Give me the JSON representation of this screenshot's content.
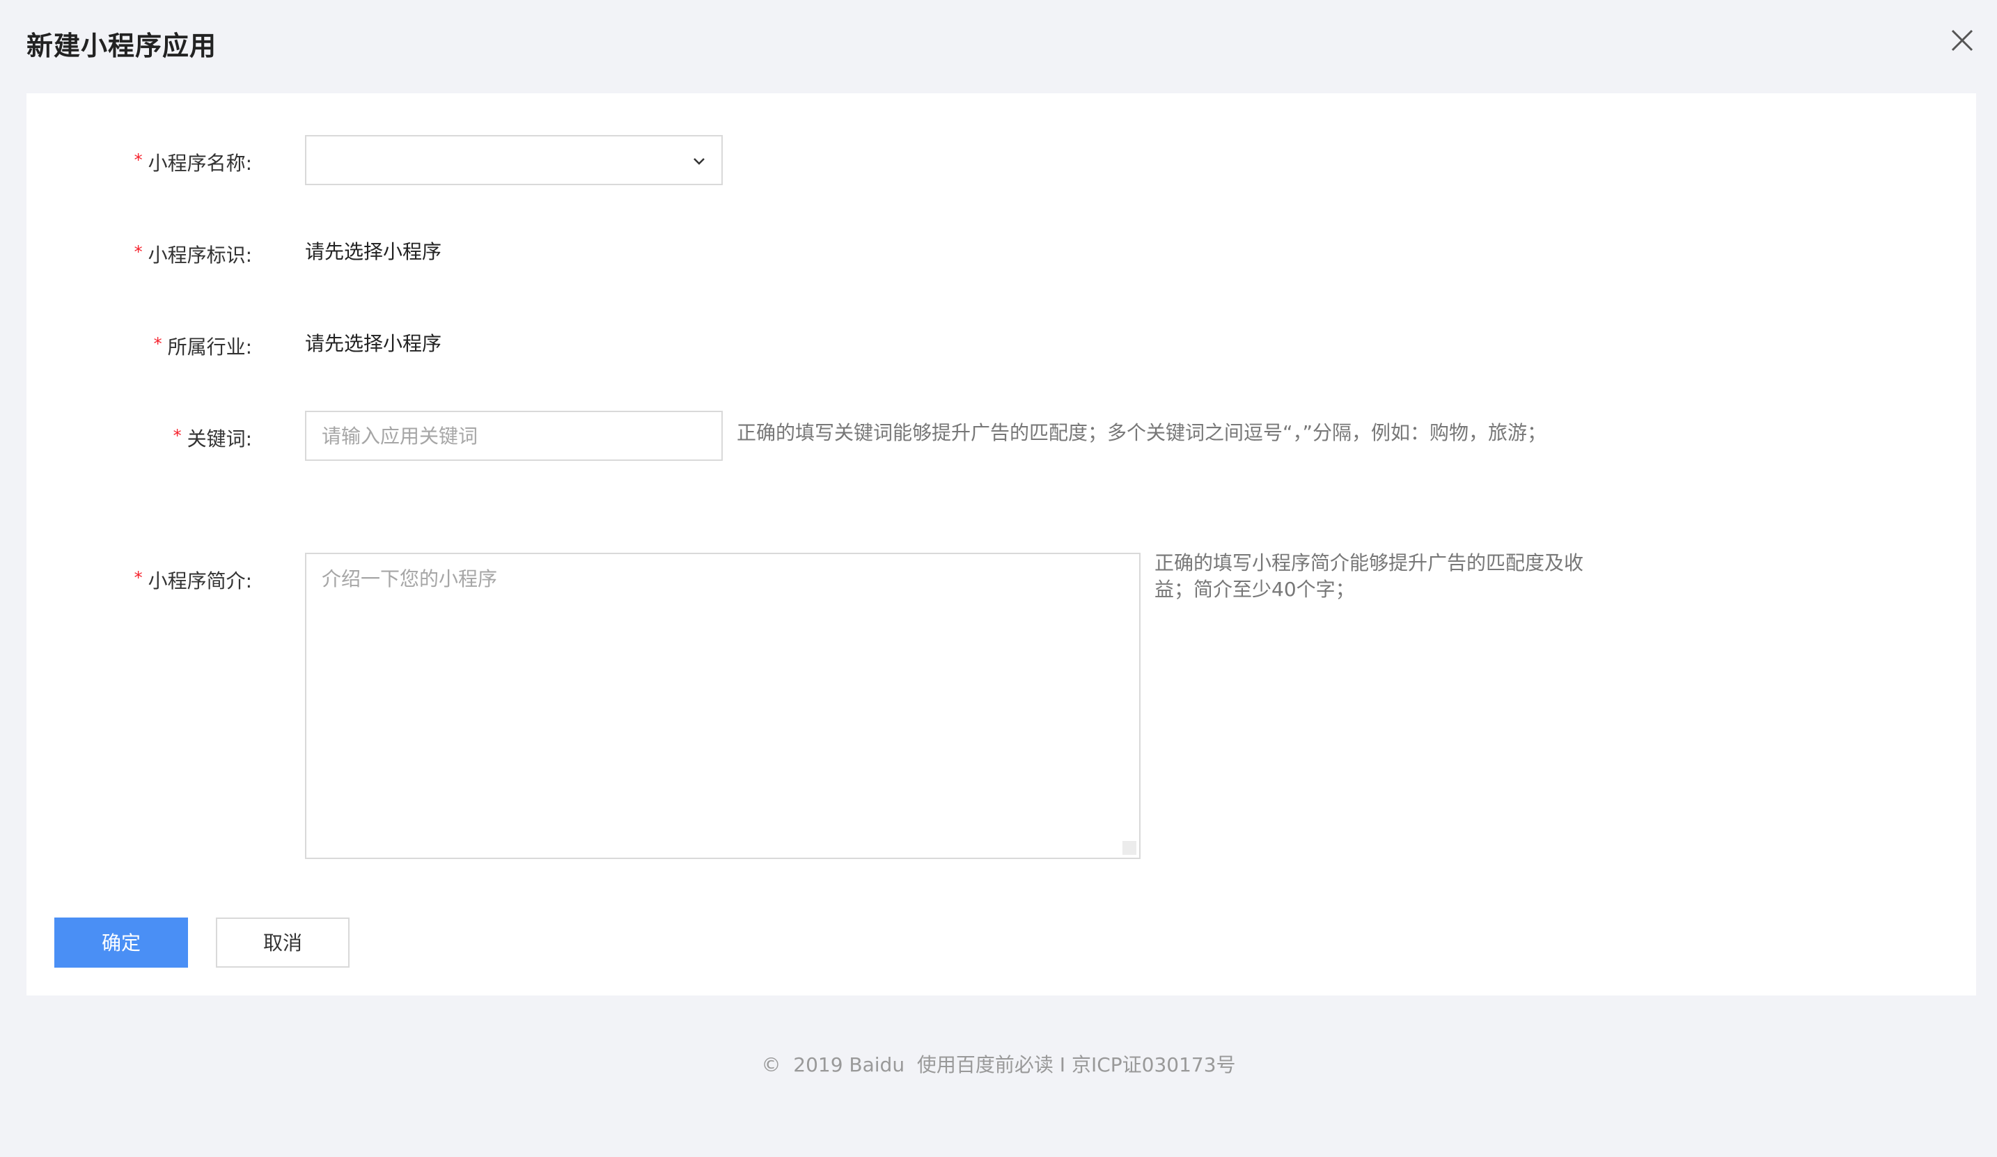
{
  "dialog": {
    "title": "新建小程序应用"
  },
  "form": {
    "name": {
      "label": "小程序名称:",
      "value": ""
    },
    "identifier": {
      "label": "小程序标识:",
      "value": "请先选择小程序"
    },
    "industry": {
      "label": "所属行业:",
      "value": "请先选择小程序"
    },
    "keywords": {
      "label": "关键词:",
      "placeholder": "请输入应用关键词",
      "hint": "正确的填写关键词能够提升广告的匹配度；多个关键词之间逗号“，”分隔，例如：购物，旅游；"
    },
    "intro": {
      "label": "小程序简介:",
      "placeholder": "介绍一下您的小程序",
      "hint": "正确的填写小程序简介能够提升广告的匹配度及收益；简介至少40个字；"
    },
    "required_mark": "*"
  },
  "actions": {
    "confirm": "确定",
    "cancel": "取消"
  },
  "footer": {
    "copyright": "©  2019 Baidu  使用百度前必读 I 京ICP证030173号"
  },
  "icons": {
    "close": "close-icon",
    "dropdown": "chevron-down-icon",
    "resize": "resize-handle-icon"
  },
  "colors": {
    "primary": "#4a8ff5",
    "required": "#f5222d",
    "background": "#f2f3f7"
  }
}
